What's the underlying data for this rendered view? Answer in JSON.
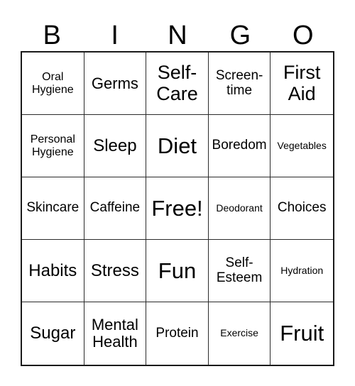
{
  "card": {
    "header_letters": [
      "B",
      "I",
      "N",
      "G",
      "O"
    ],
    "grid": {
      "rows": 5,
      "columns": 5,
      "cells": [
        {
          "label": "Oral\nHygiene",
          "size": "sm"
        },
        {
          "label": "Germs",
          "size": "lg"
        },
        {
          "label": "Self-\nCare",
          "size": "xxl"
        },
        {
          "label": "Screen-\ntime",
          "size": "md"
        },
        {
          "label": "First\nAid",
          "size": "xxl"
        },
        {
          "label": "Personal\nHygiene",
          "size": "sm"
        },
        {
          "label": "Sleep",
          "size": "xl"
        },
        {
          "label": "Diet",
          "size": "huge"
        },
        {
          "label": "Boredom",
          "size": "md"
        },
        {
          "label": "Vegetables",
          "size": "xs"
        },
        {
          "label": "Skincare",
          "size": "md"
        },
        {
          "label": "Caffeine",
          "size": "md"
        },
        {
          "label": "Free!",
          "size": "huge"
        },
        {
          "label": "Deodorant",
          "size": "xs"
        },
        {
          "label": "Choices",
          "size": "md"
        },
        {
          "label": "Habits",
          "size": "xl"
        },
        {
          "label": "Stress",
          "size": "xl"
        },
        {
          "label": "Fun",
          "size": "huge"
        },
        {
          "label": "Self-\nEsteem",
          "size": "md"
        },
        {
          "label": "Hydration",
          "size": "xs"
        },
        {
          "label": "Sugar",
          "size": "xl"
        },
        {
          "label": "Mental\nHealth",
          "size": "lg"
        },
        {
          "label": "Protein",
          "size": "md"
        },
        {
          "label": "Exercise",
          "size": "xs"
        },
        {
          "label": "Fruit",
          "size": "huge"
        }
      ]
    },
    "colors": {
      "background": "#ffffff",
      "text": "#000000",
      "grid_line": "#2b2b2b",
      "grid_border": "#1a1a1a"
    }
  }
}
